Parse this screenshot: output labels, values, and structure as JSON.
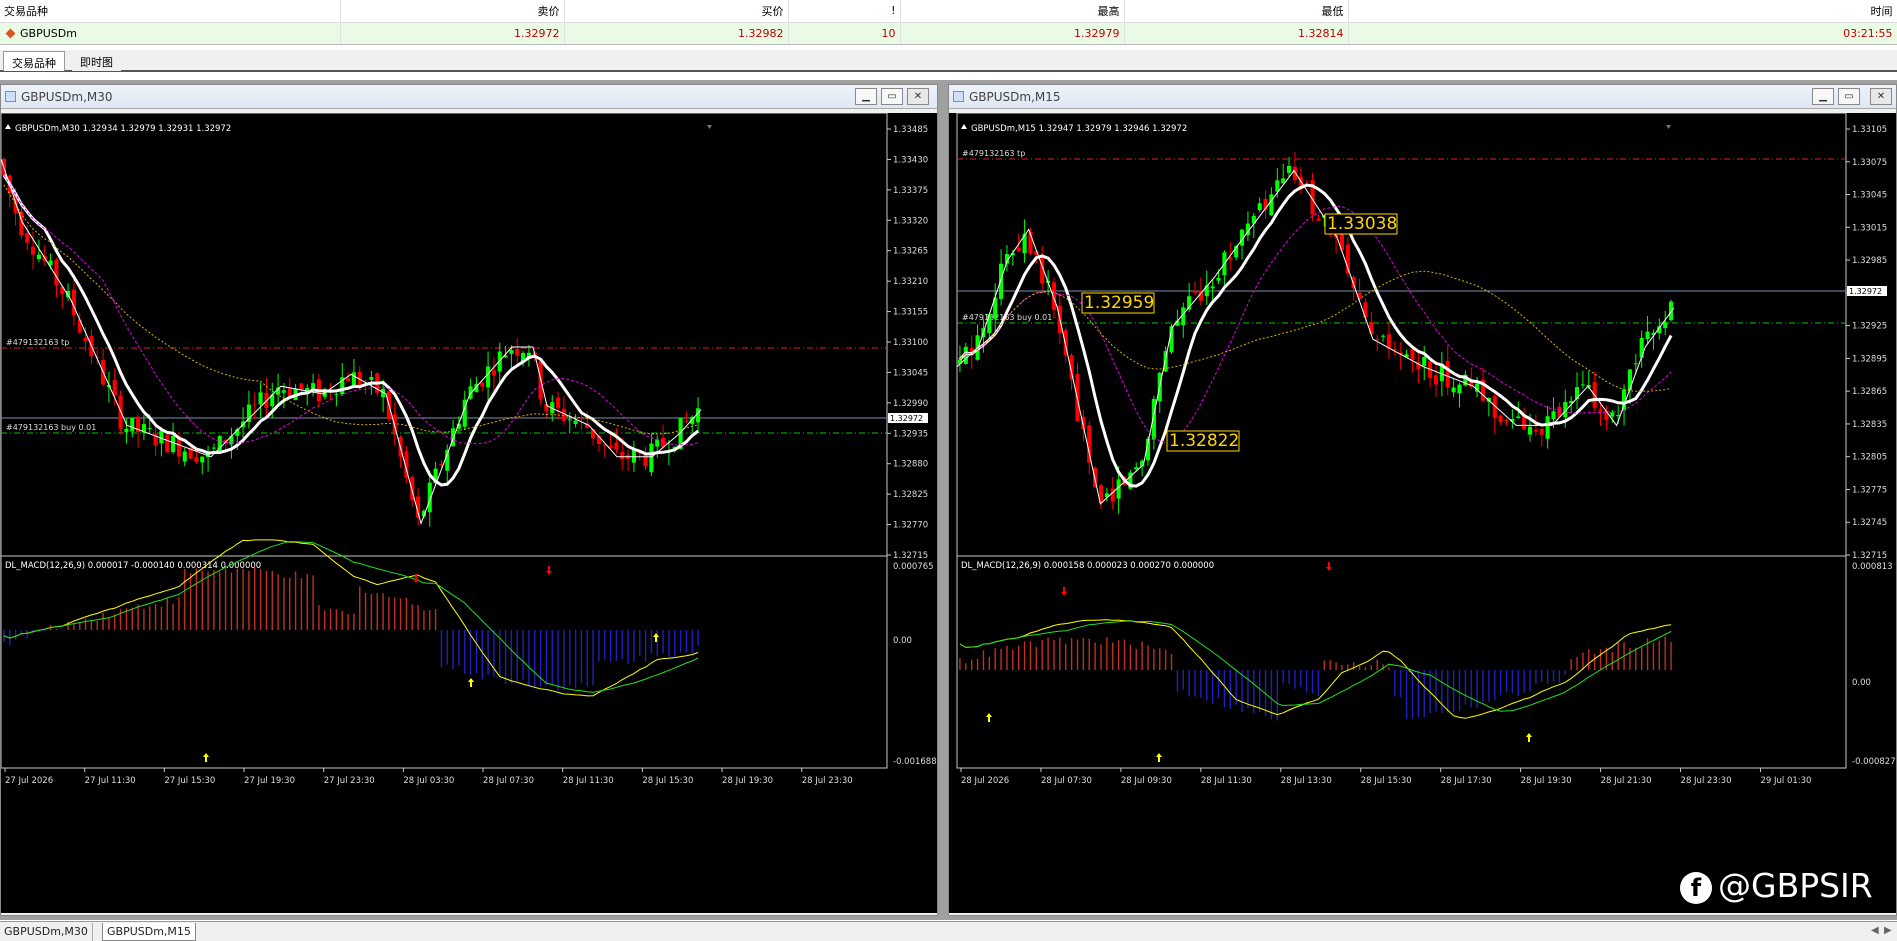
{
  "quote_window": {
    "headers": [
      "交易品种",
      "卖价",
      "买价",
      "!",
      "最高",
      "最低",
      "时间"
    ],
    "row": {
      "symbol": "GBPUSDm",
      "bid": "1.32972",
      "ask": "1.32982",
      "spread": "10",
      "high": "1.32979",
      "low": "1.32814",
      "time": "03:21:55"
    },
    "tabs": [
      "交易品种",
      "即时图"
    ]
  },
  "windows": [
    {
      "title": "GBPUSDm,M30",
      "info": "GBPUSDm,M30  1.32934 1.32979 1.32931 1.32972",
      "yticks": [
        "1.33485",
        "1.33430",
        "1.33375",
        "1.33320",
        "1.33265",
        "1.33210",
        "1.33155",
        "1.33100",
        "1.33045",
        "1.32990",
        "1.32935",
        "1.32880",
        "1.32825",
        "1.32770",
        "1.32715"
      ],
      "price_tag": "1.32972",
      "tp_label": "#479132163 tp",
      "buy_label": "#479132163 buy 0.01",
      "macd_label": "DL_MACD(12,26,9) 0.000017 -0.000140 0.000314 0.000000",
      "macd_ticks": [
        "0.000765",
        "0.00",
        "-0.001688"
      ],
      "xticks": [
        "27 Jul 2026",
        "27 Jul 11:30",
        "27 Jul 15:30",
        "27 Jul 19:30",
        "27 Jul 23:30",
        "28 Jul 03:30",
        "28 Jul 07:30",
        "28 Jul 11:30",
        "28 Jul 15:30",
        "28 Jul 19:30",
        "28 Jul 23:30"
      ]
    },
    {
      "title": "GBPUSDm,M15",
      "info": "GBPUSDm,M15  1.32947 1.32979 1.32946 1.32972",
      "yticks": [
        "1.33105",
        "1.33075",
        "1.33045",
        "1.33015",
        "1.32985",
        "1.32955",
        "1.32925",
        "1.32895",
        "1.32865",
        "1.32835",
        "1.32805",
        "1.32775",
        "1.32745",
        "1.32715"
      ],
      "price_tag": "1.32972",
      "tp_label": "#479132163 tp",
      "buy_label": "#479132163 buy 0.01",
      "annotations": [
        "1.33038",
        "1.32959",
        "1.32822"
      ],
      "macd_label": "DL_MACD(12,26,9) 0.000158 0.000023 0.000270 0.000000",
      "macd_ticks": [
        "0.000813",
        "0.00",
        "-0.000827"
      ],
      "xticks": [
        "28 Jul 2026",
        "28 Jul 07:30",
        "28 Jul 09:30",
        "28 Jul 11:30",
        "28 Jul 13:30",
        "28 Jul 15:30",
        "28 Jul 17:30",
        "28 Jul 19:30",
        "28 Jul 21:30",
        "28 Jul 23:30",
        "29 Jul 01:30"
      ]
    }
  ],
  "bottom_tabs": [
    "GBPUSDm,M30",
    "GBPUSDm,M15"
  ],
  "watermark": "@GBPSIR",
  "colors": {
    "bull": "#00ff00",
    "bear": "#ff0000",
    "ma_white": "#ffffff",
    "ma_magenta": "#e000e0",
    "ma_yellow": "#d4b400",
    "macd_red": "#c03020",
    "macd_blue": "#2020c0",
    "signal_yellow": "#ffff00",
    "signal_green": "#20e020"
  }
}
